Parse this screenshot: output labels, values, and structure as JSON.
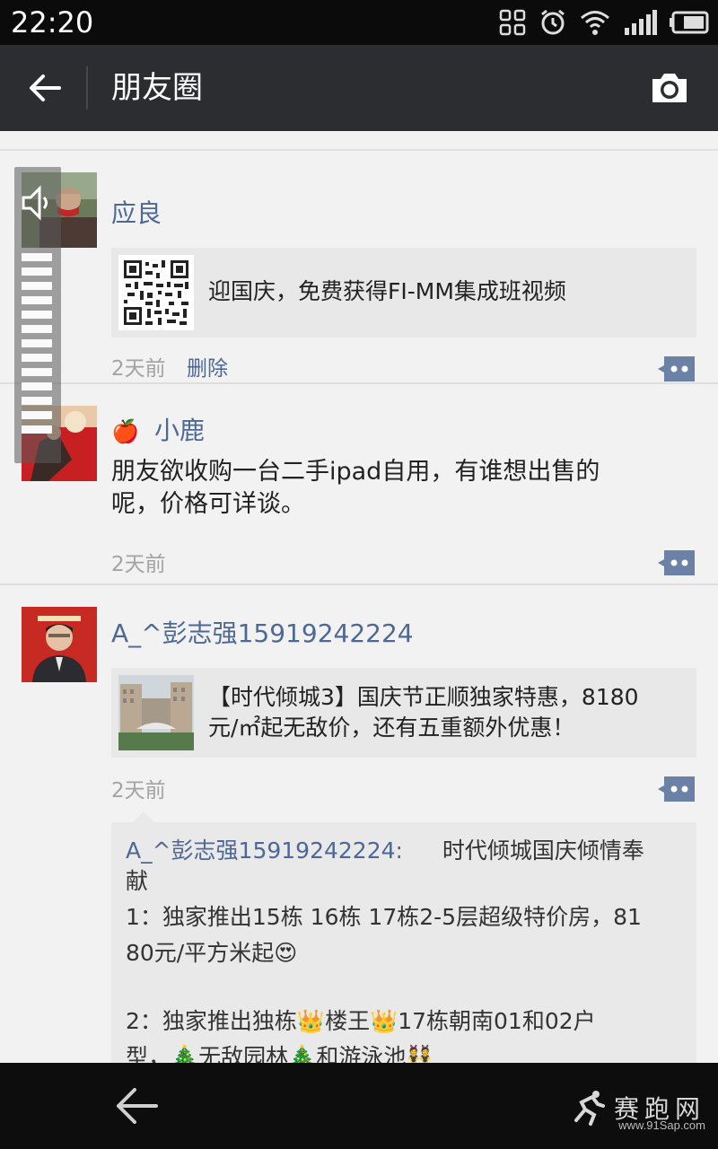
{
  "status_bar": {
    "time": "22:20"
  },
  "action_bar": {
    "title": "朋友圈"
  },
  "posts": [
    {
      "author": "应良",
      "link_title": "迎国庆，免费获得FI-MM集成班视频",
      "time": "2天前",
      "delete_label": "删除"
    },
    {
      "author": "小鹿",
      "author_emoji": "🍎",
      "text_line1": "朋友欲收购一台二手ipad自用，有谁想出售的",
      "text_line2": "呢，价格可详谈。",
      "time": "2天前"
    },
    {
      "author": "A_^彭志强15919242224",
      "link_line1": "【时代倾城3】国庆节正顺独家特惠，8180",
      "link_line2": "元/㎡起无敌价，还有五重额外优惠！",
      "time": "2天前",
      "comment": {
        "user": "A_^彭志强15919242224:",
        "line1_text": "时代倾城国庆倾情奉",
        "line2": "献",
        "line3": "1：独家推出15栋 16栋 17栋2-5层超级特价房，81",
        "line4": "80元/平方米起",
        "line4_emoji": "😍",
        "line6a": "2：独家推出独栋",
        "line6_emoji1": "👑",
        "line6b": "楼王",
        "line6_emoji2": "👑",
        "line6c": "17栋朝南01和02户",
        "line7a": "型，",
        "line7_emoji1": "🎄",
        "line7b": "无敌园林",
        "line7_emoji2": "🎄",
        "line7c": "和游泳池",
        "line7_emoji3": "👯"
      }
    }
  ],
  "watermark": {
    "text": "赛跑网",
    "url": "www.91Sap.com"
  },
  "colors": {
    "header": "#2c2d31",
    "author": "#4e6896",
    "background": "#f2f2f2"
  }
}
